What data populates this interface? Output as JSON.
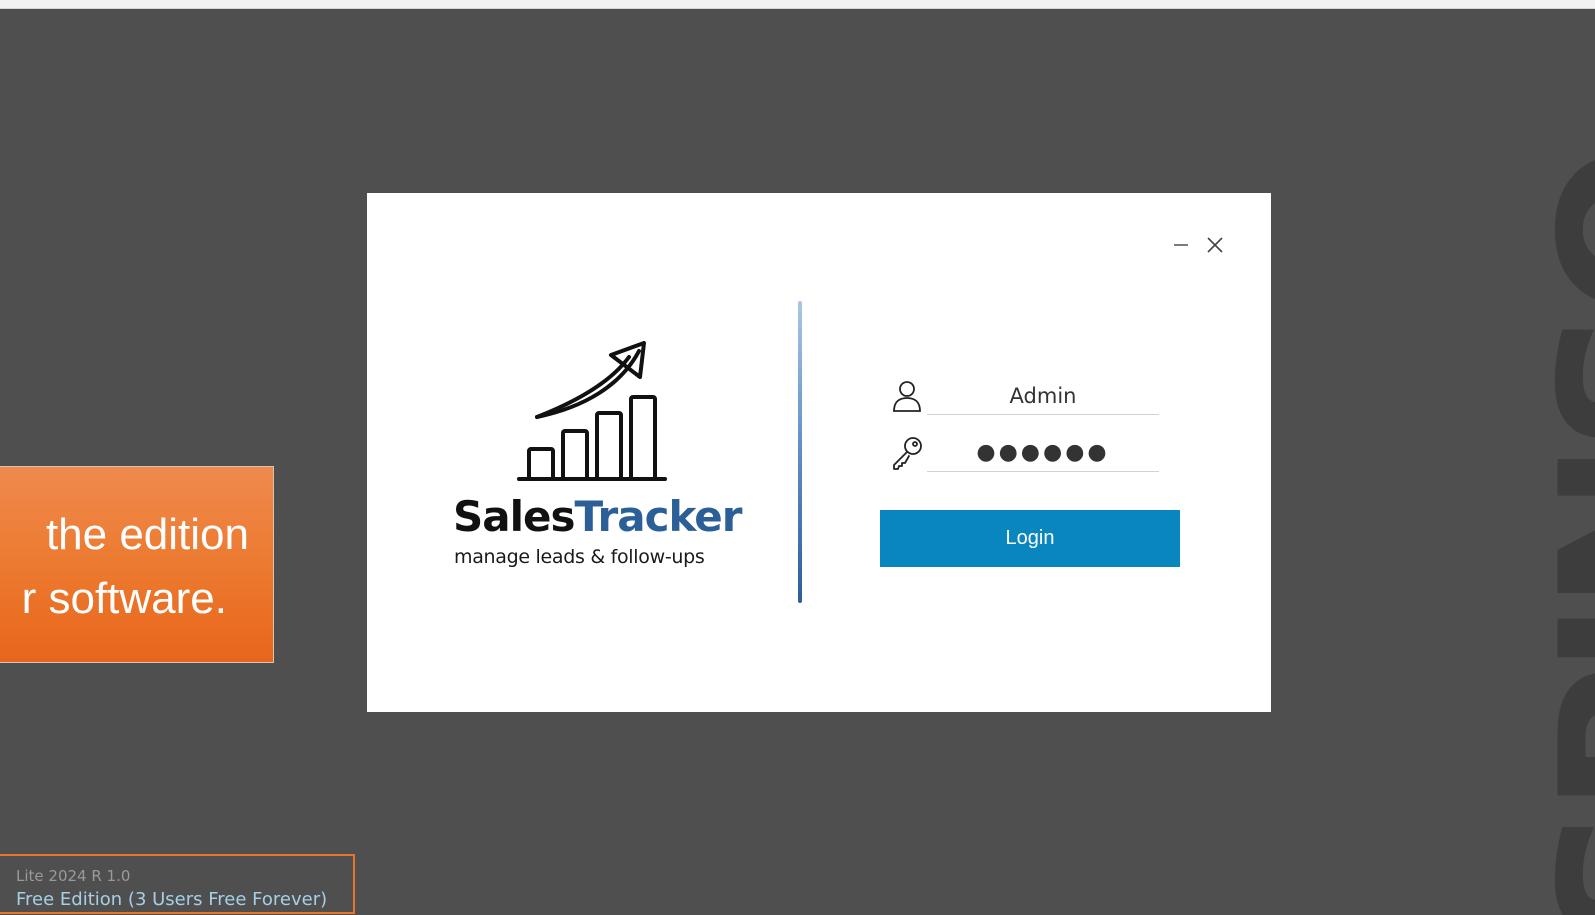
{
  "watermark": {
    "text": "SPINSO"
  },
  "callout": {
    "line1": "the edition",
    "line2": "r software."
  },
  "edition": {
    "version": "Lite 2024 R 1.0",
    "name": "Free Edition (3 Users Free Forever)"
  },
  "dialog": {
    "logo": {
      "title_part1": "Sales",
      "title_part2": "Tracker",
      "tagline": "manage leads & follow-ups"
    },
    "username": {
      "value": "Admin"
    },
    "password": {
      "value": "●●●●●●"
    },
    "login_label": "Login",
    "window_buttons": {
      "minimize": "minimize-icon",
      "close": "close-icon"
    }
  },
  "colors": {
    "background": "#4f4f4f",
    "accent_orange": "#ec7a30",
    "login_button": "#0a86bf",
    "brand_blue": "#2b5f98",
    "edition_text": "#a6cfe6"
  }
}
